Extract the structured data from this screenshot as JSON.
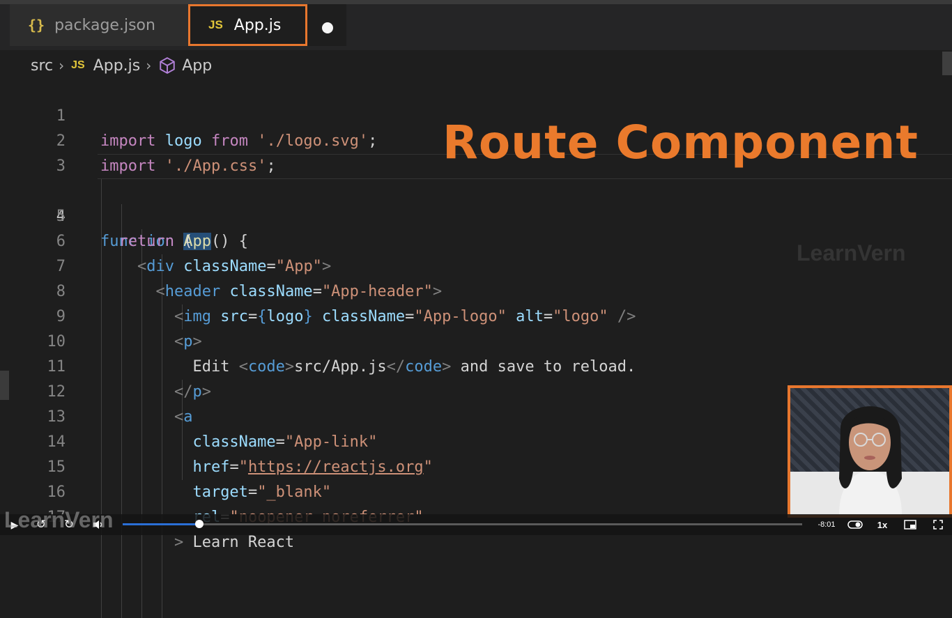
{
  "tabs": [
    {
      "label": "package.json",
      "icon": "braces-icon",
      "icon_text": "{}"
    },
    {
      "label": "App.js",
      "icon": "js-icon",
      "icon_text": "JS",
      "active": true,
      "unsaved": true
    }
  ],
  "breadcrumb": {
    "folder": "src",
    "file_icon_text": "JS",
    "file": "App.js",
    "symbol": "App"
  },
  "editor": {
    "active_line": 4,
    "line_numbers": [
      "1",
      "2",
      "3",
      "4",
      "5",
      "6",
      "7",
      "8",
      "9",
      "10",
      "11",
      "12",
      "13",
      "14",
      "15",
      "16",
      "17"
    ],
    "l1": {
      "kw_import": "import",
      "logo": "logo",
      "kw_from": "from",
      "path": "'./logo.svg'",
      "semi": ";"
    },
    "l2": {
      "kw_import": "import",
      "path": "'./App.css'",
      "semi": ";"
    },
    "l4": {
      "kw_function": "function",
      "name": "App",
      "rest": "() {"
    },
    "l5": {
      "kw_return": "return",
      "paren": "("
    },
    "l6": {
      "open": "<",
      "tag": "div",
      "attr": "className",
      "eq": "=",
      "val": "\"App\"",
      "close": ">"
    },
    "l7": {
      "open": "<",
      "tag": "header",
      "attr": "className",
      "eq": "=",
      "val": "\"App-header\"",
      "close": ">"
    },
    "l8": {
      "open": "<",
      "tag": "img",
      "attr1": "src",
      "eq1": "=",
      "brace_open": "{",
      "val1": "logo",
      "brace_close": "}",
      "attr2": "className",
      "eq2": "=",
      "val2": "\"App-logo\"",
      "attr3": "alt",
      "eq3": "=",
      "val3": "\"logo\"",
      "close": "/>"
    },
    "l9": {
      "open": "<",
      "tag": "p",
      "close": ">"
    },
    "l10": {
      "text1": "Edit ",
      "open1": "<",
      "tag1": "code",
      "close1": ">",
      "inner": "src/App.js",
      "open2": "</",
      "tag2": "code",
      "close2": ">",
      "text2": " and save to reload."
    },
    "l11": {
      "open": "</",
      "tag": "p",
      "close": ">"
    },
    "l12": {
      "open": "<",
      "tag": "a"
    },
    "l13": {
      "attr": "className",
      "eq": "=",
      "val": "\"App-link\""
    },
    "l14": {
      "attr": "href",
      "eq": "=",
      "q1": "\"",
      "url": "https://reactjs.org",
      "q2": "\""
    },
    "l15": {
      "attr": "target",
      "eq": "=",
      "val": "\"_blank\""
    },
    "l16": {
      "attr": "rel",
      "eq": "=",
      "val": "\"noopener noreferrer\""
    },
    "l17": {
      "close": ">"
    },
    "l18": {
      "text": "Learn React"
    }
  },
  "overlay": {
    "title": "Route Component",
    "title_color": "#ea7a2c",
    "watermark": "LearnVern"
  },
  "player": {
    "time_remaining": "-8:01",
    "speed": "1x",
    "progress": 0.113,
    "accent": "#2a6fd6"
  },
  "colors": {
    "keyword": "#c586c0",
    "storage": "#569cd6",
    "variable": "#9cdcfe",
    "function": "#dcdcaa",
    "string": "#ce9178",
    "tab_border": "#e8772e"
  }
}
